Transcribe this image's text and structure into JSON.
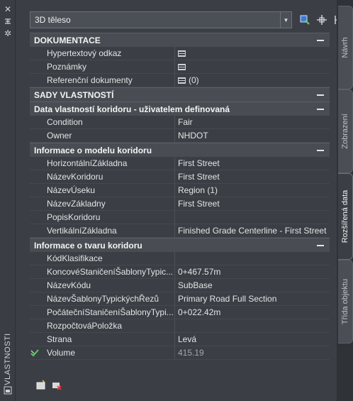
{
  "palette": {
    "bg": "#3b3f45",
    "category_bg": "#494d53",
    "text": "#e3e3e3",
    "dim_text": "#a4a8ad"
  },
  "left_strip": {
    "title": "VLASTNOSTI",
    "icons": [
      "close-icon",
      "pin-icon",
      "settings-icon",
      "properties-icon"
    ]
  },
  "toolbar": {
    "object_type": "3D těleso",
    "buttons": [
      "select-objects-icon",
      "quick-select-icon",
      "toggle-pickadd-icon"
    ]
  },
  "sections": {
    "dokumentace": {
      "title": "DOKUMENTACE",
      "rows": [
        {
          "name": "Hypertextový odkaz",
          "value": ""
        },
        {
          "name": "Poznámky",
          "value": ""
        },
        {
          "name": "Referenční dokumenty",
          "value": "(0)"
        }
      ]
    },
    "sady": {
      "title": "SADY VLASTNOSTÍ"
    },
    "data_koridoru": {
      "title": "Data vlastností koridoru - uživatelem definovaná",
      "rows": [
        {
          "name": "Condition",
          "value": "Fair"
        },
        {
          "name": "Owner",
          "value": "NHDOT"
        }
      ]
    },
    "model_koridoru": {
      "title": "Informace o modelu koridoru",
      "rows": [
        {
          "name": "HorizontálníZákladna",
          "value": "First Street"
        },
        {
          "name": "NázevKoridoru",
          "value": "First Street"
        },
        {
          "name": "NázevÚseku",
          "value": "Region (1)"
        },
        {
          "name": "NázevZákladny",
          "value": "First Street"
        },
        {
          "name": "PopisKoridoru",
          "value": ""
        },
        {
          "name": "VertikálníZákladna",
          "value": "Finished Grade Centerline - First Street"
        }
      ]
    },
    "tvar_koridoru": {
      "title": "Informace o tvaru koridoru",
      "rows": [
        {
          "name": "KódKlasifikace",
          "value": ""
        },
        {
          "name": "KoncovéStaničeníŠablonyTypic...",
          "value": "0+467.57m"
        },
        {
          "name": "NázevKódu",
          "value": "SubBase"
        },
        {
          "name": "NázevŠablonyTypickýchŘezů",
          "value": "Primary Road Full Section"
        },
        {
          "name": "PočátečníStaničeníŠablonyTypi...",
          "value": "0+022.42m"
        },
        {
          "name": "RozpočtováPoložka",
          "value": ""
        },
        {
          "name": "Strana",
          "value": "Levá"
        },
        {
          "name": "Volume",
          "value": "415.19"
        }
      ]
    }
  },
  "bottom_buttons": [
    "add-property-set-icon",
    "remove-property-set-icon"
  ],
  "tabs": [
    {
      "label": "Návrh"
    },
    {
      "label": "Zobrazení"
    },
    {
      "label": "Rozšířená data"
    },
    {
      "label": "Třída objektu"
    }
  ]
}
